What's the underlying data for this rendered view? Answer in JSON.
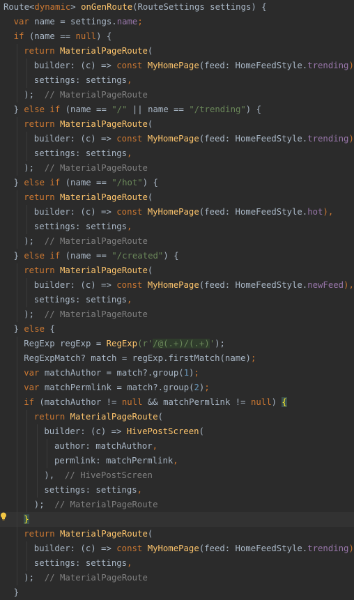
{
  "colors": {
    "background": "#2b2b2b",
    "caret_line": "#323232",
    "default": "#a9b7c6",
    "keyword": "#cc7832",
    "method": "#ffc66d",
    "field": "#9876aa",
    "string": "#6a8759",
    "number": "#6897bb",
    "comment": "#808080",
    "brace_match": "#ffef28"
  },
  "gutter": {
    "intention_icon": "lightbulb-icon"
  },
  "lines": [
    {
      "indent": 0,
      "tokens": [
        [
          "Route<",
          "default"
        ],
        [
          "dynamic",
          "keyword"
        ],
        [
          "> ",
          "default"
        ],
        [
          "onGenRoute",
          "method"
        ],
        [
          "(RouteSettings settings) {",
          "default"
        ]
      ]
    },
    {
      "indent": 1,
      "tokens": [
        [
          "var ",
          "keyword"
        ],
        [
          "name = settings.",
          "default"
        ],
        [
          "name",
          "field"
        ],
        [
          ";",
          "keyword"
        ]
      ]
    },
    {
      "indent": 1,
      "tokens": [
        [
          "if ",
          "keyword"
        ],
        [
          "(name == ",
          "default"
        ],
        [
          "null",
          "keyword"
        ],
        [
          ") {",
          "default"
        ]
      ]
    },
    {
      "indent": 2,
      "tokens": [
        [
          "return ",
          "keyword"
        ],
        [
          "MaterialPageRoute",
          "method"
        ],
        [
          "(",
          "default"
        ]
      ]
    },
    {
      "indent": 3,
      "tokens": [
        [
          "builder: (c) => ",
          "default"
        ],
        [
          "const ",
          "keyword"
        ],
        [
          "MyHomePage",
          "method"
        ],
        [
          "(feed: HomeFeedStyle.",
          "default"
        ],
        [
          "trending",
          "field"
        ],
        [
          "),",
          "keyword"
        ]
      ]
    },
    {
      "indent": 3,
      "tokens": [
        [
          "settings: settings",
          "default"
        ],
        [
          ",",
          "keyword"
        ]
      ]
    },
    {
      "indent": 2,
      "tokens": [
        [
          ");",
          "default"
        ],
        [
          "  // MaterialPageRoute",
          "comment"
        ]
      ]
    },
    {
      "indent": 1,
      "tokens": [
        [
          "} ",
          "default"
        ],
        [
          "else if ",
          "keyword"
        ],
        [
          "(name == ",
          "default"
        ],
        [
          "\"/\"",
          "string"
        ],
        [
          " || name == ",
          "default"
        ],
        [
          "\"/trending\"",
          "string"
        ],
        [
          ") {",
          "default"
        ]
      ]
    },
    {
      "indent": 2,
      "tokens": [
        [
          "return ",
          "keyword"
        ],
        [
          "MaterialPageRoute",
          "method"
        ],
        [
          "(",
          "default"
        ]
      ]
    },
    {
      "indent": 3,
      "tokens": [
        [
          "builder: (c) => ",
          "default"
        ],
        [
          "const ",
          "keyword"
        ],
        [
          "MyHomePage",
          "method"
        ],
        [
          "(feed: HomeFeedStyle.",
          "default"
        ],
        [
          "trending",
          "field"
        ],
        [
          "),",
          "keyword"
        ]
      ]
    },
    {
      "indent": 3,
      "tokens": [
        [
          "settings: settings",
          "default"
        ],
        [
          ",",
          "keyword"
        ]
      ]
    },
    {
      "indent": 2,
      "tokens": [
        [
          ");",
          "default"
        ],
        [
          "  // MaterialPageRoute",
          "comment"
        ]
      ]
    },
    {
      "indent": 1,
      "tokens": [
        [
          "} ",
          "default"
        ],
        [
          "else if ",
          "keyword"
        ],
        [
          "(name == ",
          "default"
        ],
        [
          "\"/hot\"",
          "string"
        ],
        [
          ") {",
          "default"
        ]
      ]
    },
    {
      "indent": 2,
      "tokens": [
        [
          "return ",
          "keyword"
        ],
        [
          "MaterialPageRoute",
          "method"
        ],
        [
          "(",
          "default"
        ]
      ]
    },
    {
      "indent": 3,
      "tokens": [
        [
          "builder: (c) => ",
          "default"
        ],
        [
          "const ",
          "keyword"
        ],
        [
          "MyHomePage",
          "method"
        ],
        [
          "(feed: HomeFeedStyle.",
          "default"
        ],
        [
          "hot",
          "field"
        ],
        [
          "),",
          "keyword"
        ]
      ]
    },
    {
      "indent": 3,
      "tokens": [
        [
          "settings: settings",
          "default"
        ],
        [
          ",",
          "keyword"
        ]
      ]
    },
    {
      "indent": 2,
      "tokens": [
        [
          ");",
          "default"
        ],
        [
          "  // MaterialPageRoute",
          "comment"
        ]
      ]
    },
    {
      "indent": 1,
      "tokens": [
        [
          "} ",
          "default"
        ],
        [
          "else if ",
          "keyword"
        ],
        [
          "(name == ",
          "default"
        ],
        [
          "\"/created\"",
          "string"
        ],
        [
          ") {",
          "default"
        ]
      ]
    },
    {
      "indent": 2,
      "tokens": [
        [
          "return ",
          "keyword"
        ],
        [
          "MaterialPageRoute",
          "method"
        ],
        [
          "(",
          "default"
        ]
      ]
    },
    {
      "indent": 3,
      "tokens": [
        [
          "builder: (c) => ",
          "default"
        ],
        [
          "const ",
          "keyword"
        ],
        [
          "MyHomePage",
          "method"
        ],
        [
          "(feed: HomeFeedStyle.",
          "default"
        ],
        [
          "newFeed",
          "field"
        ],
        [
          "),",
          "keyword"
        ]
      ]
    },
    {
      "indent": 3,
      "tokens": [
        [
          "settings: settings",
          "default"
        ],
        [
          ",",
          "keyword"
        ]
      ]
    },
    {
      "indent": 2,
      "tokens": [
        [
          ");",
          "default"
        ],
        [
          "  // MaterialPageRoute",
          "comment"
        ]
      ]
    },
    {
      "indent": 1,
      "tokens": [
        [
          "} ",
          "default"
        ],
        [
          "else ",
          "keyword"
        ],
        [
          "{",
          "default"
        ]
      ]
    },
    {
      "indent": 2,
      "tokens": [
        [
          "RegExp regExp = ",
          "default"
        ],
        [
          "RegExp",
          "method"
        ],
        [
          "(r'",
          "string"
        ],
        [
          "/@(.+)/(.+)",
          "regex"
        ],
        [
          "'",
          "string"
        ],
        [
          ");",
          "default"
        ]
      ]
    },
    {
      "indent": 2,
      "tokens": [
        [
          "RegExpMatch? match = regExp.firstMatch(name)",
          "default"
        ],
        [
          ";",
          "keyword"
        ]
      ]
    },
    {
      "indent": 2,
      "tokens": [
        [
          "var ",
          "keyword"
        ],
        [
          "matchAuthor = match?.group(",
          "default"
        ],
        [
          "1",
          "number"
        ],
        [
          ")",
          "default"
        ],
        [
          ";",
          "keyword"
        ]
      ]
    },
    {
      "indent": 2,
      "tokens": [
        [
          "var ",
          "keyword"
        ],
        [
          "matchPermlink = match?.group(",
          "default"
        ],
        [
          "2",
          "number"
        ],
        [
          ")",
          "default"
        ],
        [
          ";",
          "keyword"
        ]
      ]
    },
    {
      "indent": 2,
      "tokens": [
        [
          "if ",
          "keyword"
        ],
        [
          "(matchAuthor != ",
          "default"
        ],
        [
          "null ",
          "keyword"
        ],
        [
          "&& matchPermlink != ",
          "default"
        ],
        [
          "null",
          "keyword"
        ],
        [
          ") ",
          "default"
        ],
        [
          "{",
          "brace-match"
        ]
      ]
    },
    {
      "indent": 3,
      "tokens": [
        [
          "return ",
          "keyword"
        ],
        [
          "MaterialPageRoute",
          "method"
        ],
        [
          "(",
          "default"
        ]
      ]
    },
    {
      "indent": 4,
      "tokens": [
        [
          "builder: (c) => ",
          "default"
        ],
        [
          "HivePostScreen",
          "method"
        ],
        [
          "(",
          "default"
        ]
      ]
    },
    {
      "indent": 5,
      "tokens": [
        [
          "author: matchAuthor",
          "default"
        ],
        [
          ",",
          "keyword"
        ]
      ]
    },
    {
      "indent": 5,
      "tokens": [
        [
          "permlink: matchPermlink",
          "default"
        ],
        [
          ",",
          "keyword"
        ]
      ]
    },
    {
      "indent": 4,
      "tokens": [
        [
          "),",
          "default"
        ],
        [
          "  // HivePostScreen",
          "comment"
        ]
      ]
    },
    {
      "indent": 4,
      "tokens": [
        [
          "settings: settings",
          "default"
        ],
        [
          ",",
          "keyword"
        ]
      ]
    },
    {
      "indent": 3,
      "tokens": [
        [
          ");",
          "default"
        ],
        [
          "  // MaterialPageRoute",
          "comment"
        ]
      ]
    },
    {
      "indent": 2,
      "caret": true,
      "tokens": [
        [
          "}",
          "brace-match"
        ]
      ]
    },
    {
      "indent": 2,
      "tokens": [
        [
          "return ",
          "keyword"
        ],
        [
          "MaterialPageRoute",
          "method"
        ],
        [
          "(",
          "default"
        ]
      ]
    },
    {
      "indent": 3,
      "tokens": [
        [
          "builder: (c) => ",
          "default"
        ],
        [
          "const ",
          "keyword"
        ],
        [
          "MyHomePage",
          "method"
        ],
        [
          "(feed: HomeFeedStyle.",
          "default"
        ],
        [
          "trending",
          "field"
        ],
        [
          "),",
          "keyword"
        ]
      ]
    },
    {
      "indent": 3,
      "tokens": [
        [
          "settings: settings",
          "default"
        ],
        [
          ",",
          "keyword"
        ]
      ]
    },
    {
      "indent": 2,
      "tokens": [
        [
          ");",
          "default"
        ],
        [
          "  // MaterialPageRoute",
          "comment"
        ]
      ]
    },
    {
      "indent": 1,
      "tokens": [
        [
          "}",
          "default"
        ]
      ]
    }
  ]
}
